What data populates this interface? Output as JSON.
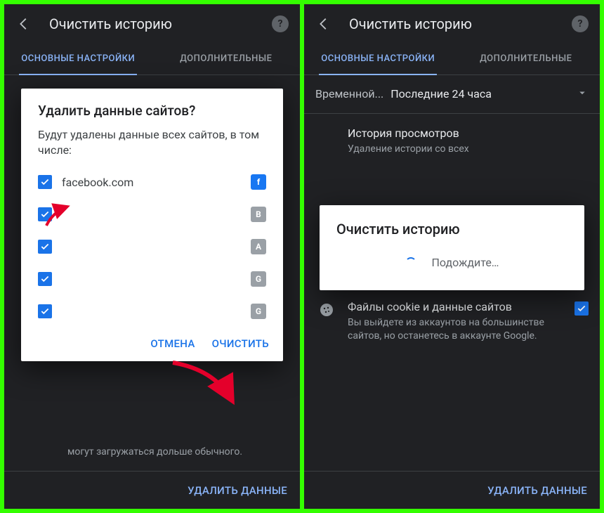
{
  "left": {
    "header": {
      "title": "Очистить историю"
    },
    "tabs": {
      "basic": "ОСНОВНЫЕ НАСТРОЙКИ",
      "advanced": "ДОПОЛНИТЕЛЬНЫЕ"
    },
    "dialog": {
      "title": "Удалить данные сайтов?",
      "message": "Будут удалены данные всех сайтов, в том числе:",
      "sites": [
        {
          "domain": "facebook.com",
          "icon": "f",
          "icon_class": "fav-fb"
        },
        {
          "domain": "",
          "icon": "B",
          "icon_class": "fav-grey"
        },
        {
          "domain": "",
          "icon": "A",
          "icon_class": "fav-grey"
        },
        {
          "domain": "",
          "icon": "G",
          "icon_class": "fav-grey"
        },
        {
          "domain": "",
          "icon": "G",
          "icon_class": "fav-grey"
        }
      ],
      "cancel": "ОТМЕНА",
      "confirm": "ОЧИСТИТЬ"
    },
    "under_text": "могут загружаться дольше обычного.",
    "bottom_action": "УДАЛИТЬ ДАННЫЕ"
  },
  "right": {
    "header": {
      "title": "Очистить историю"
    },
    "tabs": {
      "basic": "ОСНОВНЫЕ НАСТРОЙКИ",
      "advanced": "ДОПОЛНИТЕЛЬНЫЕ"
    },
    "time": {
      "label": "Временной...",
      "value": "Последние 24 часа"
    },
    "settings": {
      "history": {
        "title": "История просмотров",
        "sub": "Удаление истории со всех"
      },
      "cookies": {
        "title": "Файлы cookie и данные сайтов",
        "sub": "Вы выйдете из аккаунтов на большинстве сайтов, но останетесь в аккаунте Google."
      }
    },
    "progress": {
      "title": "Очистить историю",
      "wait": "Подождите…"
    },
    "bottom_action": "УДАЛИТЬ ДАННЫЕ"
  }
}
